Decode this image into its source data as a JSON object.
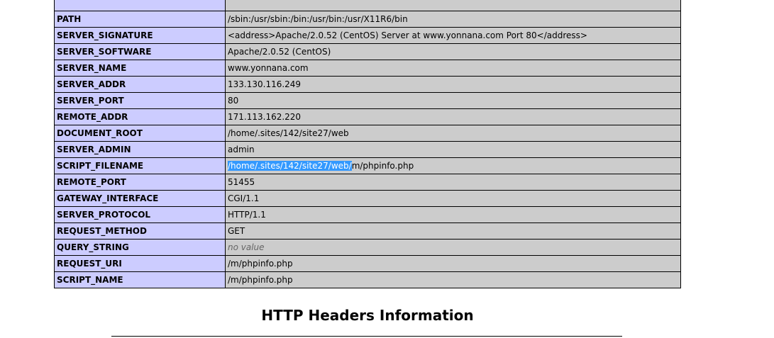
{
  "variables": [
    {
      "name": "",
      "value": ""
    },
    {
      "name": "PATH",
      "value": "/sbin:/usr/sbin:/bin:/usr/bin:/usr/X11R6/bin"
    },
    {
      "name": "SERVER_SIGNATURE",
      "value": "<address>Apache/2.0.52 (CentOS) Server at www.yonnana.com Port 80</address>"
    },
    {
      "name": "SERVER_SOFTWARE",
      "value": "Apache/2.0.52 (CentOS)"
    },
    {
      "name": "SERVER_NAME",
      "value": "www.yonnana.com"
    },
    {
      "name": "SERVER_ADDR",
      "value": "133.130.116.249"
    },
    {
      "name": "SERVER_PORT",
      "value": "80"
    },
    {
      "name": "REMOTE_ADDR",
      "value": "171.113.162.220"
    },
    {
      "name": "DOCUMENT_ROOT",
      "value": "/home/.sites/142/site27/web"
    },
    {
      "name": "SERVER_ADMIN",
      "value": "admin"
    },
    {
      "name": "SCRIPT_FILENAME",
      "value_selected": "/home/.sites/142/site27/web/",
      "value_rest": "m/phpinfo.php"
    },
    {
      "name": "REMOTE_PORT",
      "value": "51455"
    },
    {
      "name": "GATEWAY_INTERFACE",
      "value": "CGI/1.1"
    },
    {
      "name": "SERVER_PROTOCOL",
      "value": "HTTP/1.1"
    },
    {
      "name": "REQUEST_METHOD",
      "value": "GET"
    },
    {
      "name": "QUERY_STRING",
      "value": "no value"
    },
    {
      "name": "REQUEST_URI",
      "value": "/m/phpinfo.php"
    },
    {
      "name": "SCRIPT_NAME",
      "value": "/m/phpinfo.php"
    }
  ],
  "section_title": "HTTP Headers Information"
}
